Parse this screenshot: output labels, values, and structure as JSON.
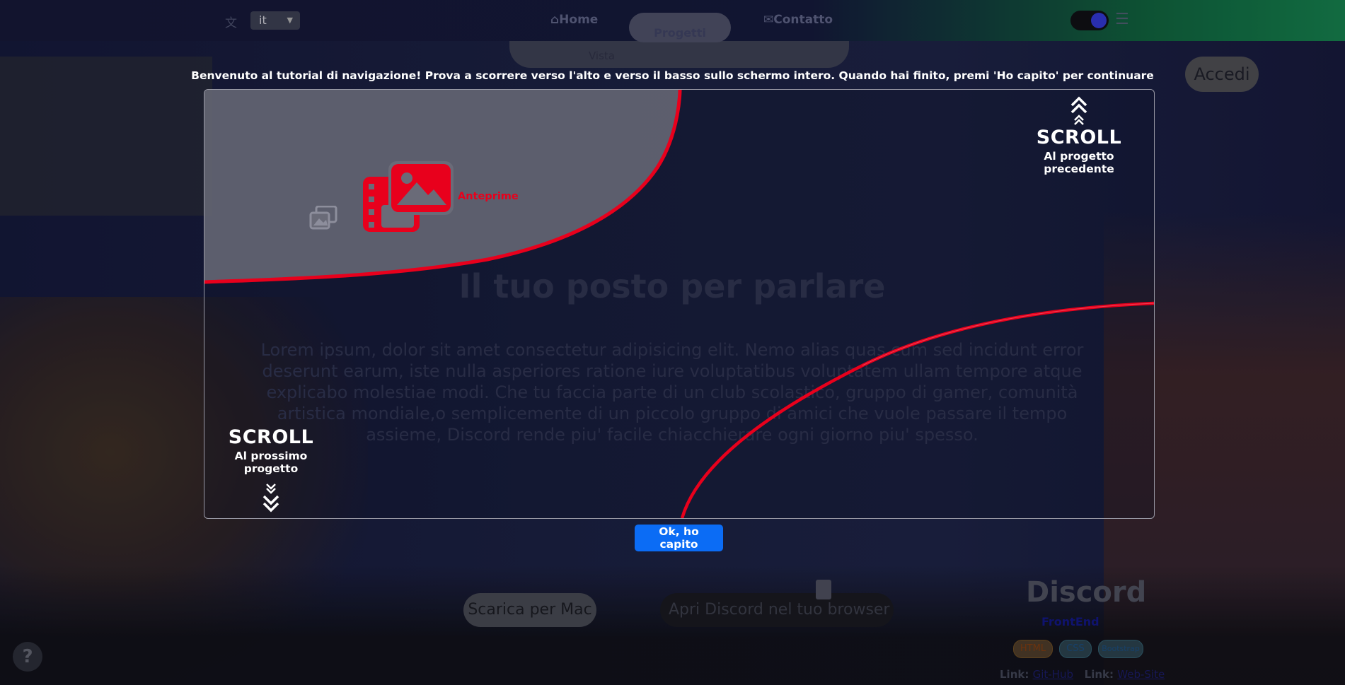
{
  "background": {
    "lang_select": {
      "value": "it"
    },
    "nav": {
      "home": "Home",
      "projects": "Progetti",
      "contact": "Contatto"
    },
    "subnav_label": "Vista",
    "login_button": "Accedi",
    "hero": {
      "title": "Il tuo posto per parlare",
      "body": "Lorem ipsum, dolor sit amet consectetur adipisicing elit. Nemo alias quas cum sed incidunt error deserunt earum, iste nulla asperiores ratione iure voluptatibus voluptatem ullam tempore atque explicabo molestiae modi. Che tu faccia parte di un club scolastico, gruppo di gamer, comunità artistica mondiale,o semplicemente di un piccolo gruppo di amici che vuole passare il tempo assieme, Discord rende piu' facile chiacchierare ogni giorno piu' spesso."
    },
    "buttons": {
      "mac": "Scarica per Mac",
      "browser": "Apri Discord nel tuo browser"
    },
    "project_card": {
      "title": "Discord",
      "subtitle": "FrontEnd",
      "chips": [
        "HTML",
        "CSS",
        "Bootstrap"
      ],
      "link1_label": "Link:",
      "link1_value": "Git-Hub",
      "link2_label": "Link:",
      "link2_value": "Web-Site"
    },
    "help_button": "?"
  },
  "tutorial": {
    "message": "Benvenuto al tutorial di navigazione! Prova a scorrere verso l'alto e verso il basso sullo schermo intero. Quando hai finito, premi 'Ho capito' per continuare",
    "previews_label": "Anteprime",
    "scroll_up": {
      "title": "SCROLL",
      "subtitle": "Al progetto precedente"
    },
    "scroll_down": {
      "title": "SCROLL",
      "subtitle": "Al prossimo progetto"
    },
    "ok_button": "Ok, ho capito",
    "accent_color": "#e8001c",
    "button_color": "#0b6cf5"
  }
}
